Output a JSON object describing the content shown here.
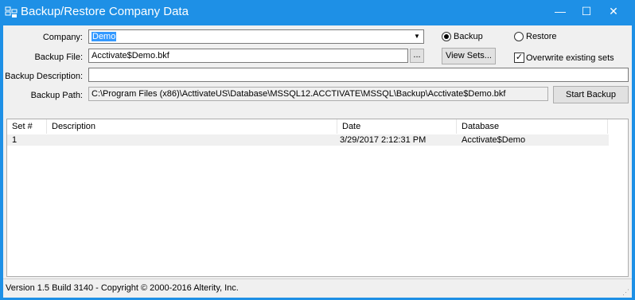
{
  "window": {
    "title": "Backup/Restore Company Data",
    "minimize_glyph": "—",
    "maximize_glyph": "☐",
    "close_glyph": "✕"
  },
  "form": {
    "company_label": "Company:",
    "company_value": "Demo",
    "backup_file_label": "Backup File:",
    "backup_file_value": "Acctivate$Demo.bkf",
    "browse_label": "...",
    "backup_description_label": "Backup Description:",
    "backup_description_value": "",
    "backup_path_label": "Backup Path:",
    "backup_path_value": "C:\\Program Files (x86)\\ActtivateUS\\Database\\MSSQL12.ACCTIVATE\\MSSQL\\Backup\\Acctivate$Demo.bkf",
    "mode_backup_label": "Backup",
    "mode_restore_label": "Restore",
    "mode_selected": "backup",
    "view_sets_label": "View Sets...",
    "overwrite_label": "Overwrite existing sets",
    "overwrite_checked": true,
    "start_backup_label": "Start Backup"
  },
  "table": {
    "columns": [
      "Set #",
      "Description",
      "Date",
      "Database"
    ],
    "rows": [
      {
        "set": "1",
        "description": "",
        "date": "3/29/2017 2:12:31 PM",
        "database": "Acctivate$Demo"
      }
    ]
  },
  "status": {
    "text": "Version 1.5 Build 3140 - Copyright © 2000-2016 Alterity, Inc."
  },
  "colors": {
    "titlebar": "#1e90e6",
    "selection": "#3399ff",
    "client_bg": "#f0f0f0"
  }
}
